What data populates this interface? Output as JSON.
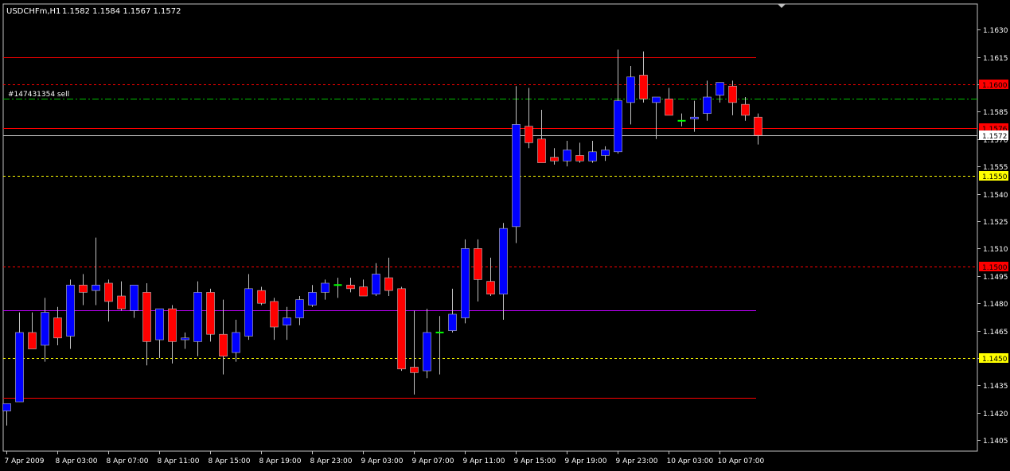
{
  "window": {
    "title_symbol": "USDCHFm,H1",
    "ohlc_readout": "1.1582 1.1584 1.1567 1.1572",
    "order_label": "#147431354 sell"
  },
  "colors": {
    "background": "#000000",
    "frame": "#c0c0c0",
    "bull_body": "#0000ff",
    "bear_body": "#ff0000",
    "wick": "#c0c0c0",
    "doji": "#00ff00",
    "text": "#ffffff",
    "level_red": "#ff0000",
    "level_yellow": "#ffff00",
    "level_purple": "#c000ff",
    "order_line": "#00c000",
    "bid_line": "#c0c0c0"
  },
  "chart_data": {
    "type": "candlestick",
    "symbol": "USDCHFm",
    "timeframe": "H1",
    "ylim": [
      1.1399,
      1.1644
    ],
    "y_ticks": [
      "1.1405",
      "1.1420",
      "1.1435",
      "1.1450",
      "1.1465",
      "1.1480",
      "1.1495",
      "1.1510",
      "1.1525",
      "1.1540",
      "1.1555",
      "1.1570",
      "1.1585",
      "1.1600",
      "1.1615",
      "1.1630"
    ],
    "x_ticks": [
      {
        "label": "7 Apr 2009",
        "bar": 0
      },
      {
        "label": "8 Apr 03:00",
        "bar": 4
      },
      {
        "label": "8 Apr 07:00",
        "bar": 8
      },
      {
        "label": "8 Apr 11:00",
        "bar": 12
      },
      {
        "label": "8 Apr 15:00",
        "bar": 16
      },
      {
        "label": "8 Apr 19:00",
        "bar": 20
      },
      {
        "label": "8 Apr 23:00",
        "bar": 24
      },
      {
        "label": "9 Apr 03:00",
        "bar": 28
      },
      {
        "label": "9 Apr 07:00",
        "bar": 32
      },
      {
        "label": "9 Apr 11:00",
        "bar": 36
      },
      {
        "label": "9 Apr 15:00",
        "bar": 40
      },
      {
        "label": "9 Apr 19:00",
        "bar": 44
      },
      {
        "label": "9 Apr 23:00",
        "bar": 48
      },
      {
        "label": "10 Apr 03:00",
        "bar": 52
      },
      {
        "label": "10 Apr 07:00",
        "bar": 56
      }
    ],
    "candles": [
      {
        "o": 1.1421,
        "h": 1.1425,
        "l": 1.1413,
        "c": 1.1425
      },
      {
        "o": 1.1426,
        "h": 1.1475,
        "l": 1.1426,
        "c": 1.1464
      },
      {
        "o": 1.1464,
        "h": 1.1475,
        "l": 1.1455,
        "c": 1.1455
      },
      {
        "o": 1.1457,
        "h": 1.1483,
        "l": 1.1448,
        "c": 1.1475
      },
      {
        "o": 1.1472,
        "h": 1.1478,
        "l": 1.1457,
        "c": 1.1461
      },
      {
        "o": 1.1462,
        "h": 1.1493,
        "l": 1.1455,
        "c": 1.149
      },
      {
        "o": 1.149,
        "h": 1.1496,
        "l": 1.1479,
        "c": 1.1486
      },
      {
        "o": 1.1487,
        "h": 1.1516,
        "l": 1.1479,
        "c": 1.149
      },
      {
        "o": 1.1491,
        "h": 1.1493,
        "l": 1.147,
        "c": 1.1481
      },
      {
        "o": 1.1484,
        "h": 1.1492,
        "l": 1.1476,
        "c": 1.1477
      },
      {
        "o": 1.1476,
        "h": 1.1489,
        "l": 1.1472,
        "c": 1.149
      },
      {
        "o": 1.1486,
        "h": 1.1491,
        "l": 1.1446,
        "c": 1.1459
      },
      {
        "o": 1.146,
        "h": 1.1477,
        "l": 1.145,
        "c": 1.1477
      },
      {
        "o": 1.1477,
        "h": 1.1479,
        "l": 1.1447,
        "c": 1.1459
      },
      {
        "o": 1.146,
        "h": 1.1464,
        "l": 1.1455,
        "c": 1.1461
      },
      {
        "o": 1.1459,
        "h": 1.1492,
        "l": 1.1451,
        "c": 1.1486
      },
      {
        "o": 1.1486,
        "h": 1.1488,
        "l": 1.1459,
        "c": 1.1463
      },
      {
        "o": 1.1463,
        "h": 1.1482,
        "l": 1.1441,
        "c": 1.1451
      },
      {
        "o": 1.1453,
        "h": 1.1471,
        "l": 1.1448,
        "c": 1.1464
      },
      {
        "o": 1.1462,
        "h": 1.1496,
        "l": 1.146,
        "c": 1.1488
      },
      {
        "o": 1.1487,
        "h": 1.1489,
        "l": 1.1479,
        "c": 1.148
      },
      {
        "o": 1.1481,
        "h": 1.1483,
        "l": 1.146,
        "c": 1.1467
      },
      {
        "o": 1.1468,
        "h": 1.1478,
        "l": 1.146,
        "c": 1.1472
      },
      {
        "o": 1.1472,
        "h": 1.1484,
        "l": 1.1468,
        "c": 1.1482
      },
      {
        "o": 1.1479,
        "h": 1.149,
        "l": 1.1478,
        "c": 1.1486
      },
      {
        "o": 1.1486,
        "h": 1.1493,
        "l": 1.1482,
        "c": 1.1491
      },
      {
        "o": 1.149,
        "h": 1.1494,
        "l": 1.1483,
        "c": 1.149
      },
      {
        "o": 1.149,
        "h": 1.1494,
        "l": 1.1486,
        "c": 1.1488
      },
      {
        "o": 1.1489,
        "h": 1.1493,
        "l": 1.1484,
        "c": 1.1484
      },
      {
        "o": 1.1485,
        "h": 1.1502,
        "l": 1.1484,
        "c": 1.1496
      },
      {
        "o": 1.1494,
        "h": 1.1505,
        "l": 1.1484,
        "c": 1.1487
      },
      {
        "o": 1.1488,
        "h": 1.1489,
        "l": 1.1443,
        "c": 1.1444
      },
      {
        "o": 1.1445,
        "h": 1.1476,
        "l": 1.143,
        "c": 1.1442
      },
      {
        "o": 1.1443,
        "h": 1.1477,
        "l": 1.1439,
        "c": 1.1464
      },
      {
        "o": 1.1464,
        "h": 1.1473,
        "l": 1.1441,
        "c": 1.1464
      },
      {
        "o": 1.1465,
        "h": 1.1488,
        "l": 1.1464,
        "c": 1.1474
      },
      {
        "o": 1.1472,
        "h": 1.1515,
        "l": 1.1469,
        "c": 1.151
      },
      {
        "o": 1.151,
        "h": 1.1515,
        "l": 1.1481,
        "c": 1.1493
      },
      {
        "o": 1.1492,
        "h": 1.1505,
        "l": 1.1484,
        "c": 1.1485
      },
      {
        "o": 1.1485,
        "h": 1.1524,
        "l": 1.1471,
        "c": 1.1521
      },
      {
        "o": 1.1522,
        "h": 1.1599,
        "l": 1.1513,
        "c": 1.1578
      },
      {
        "o": 1.1577,
        "h": 1.1598,
        "l": 1.1565,
        "c": 1.1568
      },
      {
        "o": 1.157,
        "h": 1.1586,
        "l": 1.1562,
        "c": 1.1557
      },
      {
        "o": 1.156,
        "h": 1.1565,
        "l": 1.1556,
        "c": 1.1558
      },
      {
        "o": 1.1558,
        "h": 1.1569,
        "l": 1.1555,
        "c": 1.1564
      },
      {
        "o": 1.1561,
        "h": 1.1568,
        "l": 1.1557,
        "c": 1.1558
      },
      {
        "o": 1.1558,
        "h": 1.1569,
        "l": 1.1557,
        "c": 1.1563
      },
      {
        "o": 1.1561,
        "h": 1.1566,
        "l": 1.1558,
        "c": 1.1564
      },
      {
        "o": 1.1563,
        "h": 1.1619,
        "l": 1.1562,
        "c": 1.1591
      },
      {
        "o": 1.159,
        "h": 1.161,
        "l": 1.1578,
        "c": 1.1604
      },
      {
        "o": 1.1605,
        "h": 1.1618,
        "l": 1.159,
        "c": 1.1592
      },
      {
        "o": 1.159,
        "h": 1.1593,
        "l": 1.157,
        "c": 1.1593
      },
      {
        "o": 1.1592,
        "h": 1.1598,
        "l": 1.1583,
        "c": 1.1583
      },
      {
        "o": 1.158,
        "h": 1.1584,
        "l": 1.1577,
        "c": 1.158
      },
      {
        "o": 1.1581,
        "h": 1.1591,
        "l": 1.1574,
        "c": 1.1582
      },
      {
        "o": 1.1584,
        "h": 1.1602,
        "l": 1.158,
        "c": 1.1593
      },
      {
        "o": 1.1594,
        "h": 1.1601,
        "l": 1.159,
        "c": 1.1601
      },
      {
        "o": 1.1599,
        "h": 1.1602,
        "l": 1.1583,
        "c": 1.159
      },
      {
        "o": 1.1589,
        "h": 1.1593,
        "l": 1.158,
        "c": 1.1583
      },
      {
        "o": 1.1582,
        "h": 1.1584,
        "l": 1.1567,
        "c": 1.1572
      }
    ],
    "levels": [
      {
        "name": "resistance-high",
        "price": 1.1615,
        "color": "#ff0000",
        "style": "solid",
        "label": ""
      },
      {
        "name": "level-1-1600",
        "price": 1.16,
        "color": "#ff0000",
        "style": "dashed",
        "label": "1.1600",
        "label_bg": "#ff0000"
      },
      {
        "name": "order-sell",
        "price": 1.1592,
        "color": "#00c000",
        "style": "dashdot",
        "label": ""
      },
      {
        "name": "level-1-1576",
        "price": 1.1576,
        "color": "#ff0000",
        "style": "solid",
        "label": "1.1576",
        "label_bg": "#ff0000"
      },
      {
        "name": "bid-line",
        "price": 1.1572,
        "color": "#c0c0c0",
        "style": "solid",
        "label": "1.1572",
        "label_bg": "#ffffff"
      },
      {
        "name": "level-1-1550",
        "price": 1.155,
        "color": "#ffff00",
        "style": "dashed",
        "label": "1.1550",
        "label_bg": "#ffff00"
      },
      {
        "name": "level-1-1500",
        "price": 1.15,
        "color": "#ff0000",
        "style": "dashed",
        "label": "1.1500",
        "label_bg": "#ff0000"
      },
      {
        "name": "purple-line",
        "price": 1.1476,
        "color": "#c000ff",
        "style": "solid",
        "label": ""
      },
      {
        "name": "level-1-1450",
        "price": 1.145,
        "color": "#ffff00",
        "style": "dashed",
        "label": "1.1450",
        "label_bg": "#ffff00"
      },
      {
        "name": "support-low",
        "price": 1.1428,
        "color": "#ff0000",
        "style": "solid",
        "label": ""
      }
    ]
  }
}
